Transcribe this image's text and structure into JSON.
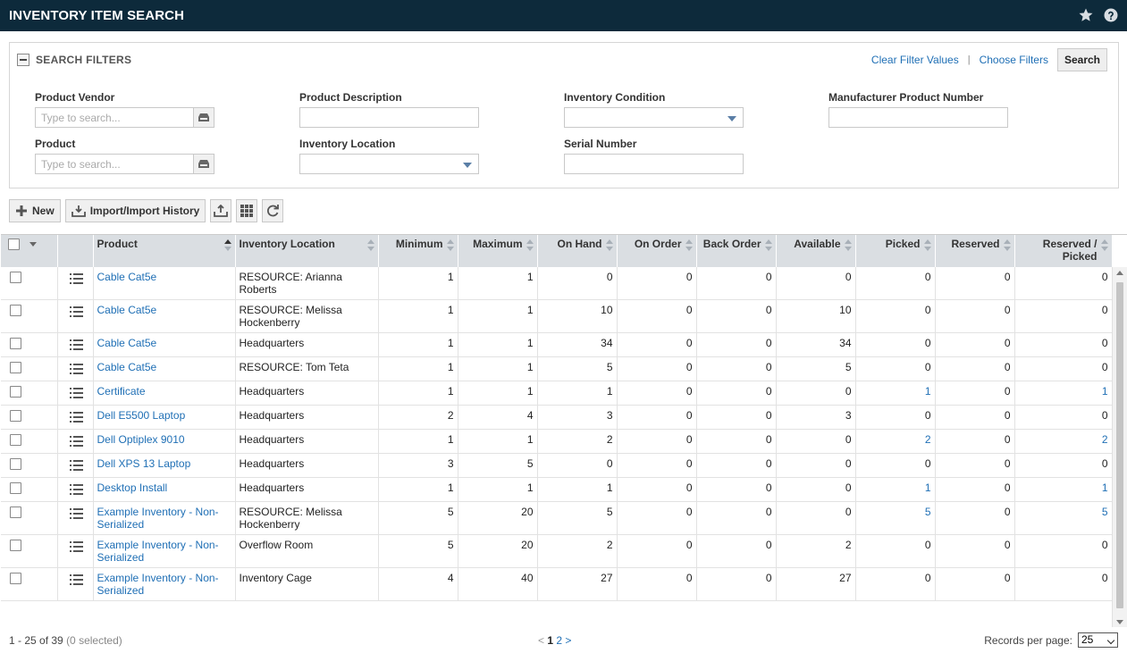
{
  "header": {
    "title": "INVENTORY ITEM SEARCH"
  },
  "filters": {
    "title": "SEARCH FILTERS",
    "clear_label": "Clear Filter Values",
    "choose_label": "Choose Filters",
    "search_label": "Search",
    "fields": {
      "product_vendor": {
        "label": "Product Vendor",
        "placeholder": "Type to search..."
      },
      "product": {
        "label": "Product",
        "placeholder": "Type to search..."
      },
      "product_description": {
        "label": "Product Description",
        "value": ""
      },
      "inventory_location": {
        "label": "Inventory Location",
        "value": ""
      },
      "inventory_condition": {
        "label": "Inventory Condition",
        "value": ""
      },
      "serial_number": {
        "label": "Serial Number",
        "value": ""
      },
      "manufacturer_product_number": {
        "label": "Manufacturer Product Number",
        "value": ""
      }
    }
  },
  "toolbar": {
    "new_label": "New",
    "import_label": "Import/Import History"
  },
  "table": {
    "columns": {
      "product": "Product",
      "location": "Inventory Location",
      "minimum": "Minimum",
      "maximum": "Maximum",
      "on_hand": "On Hand",
      "on_order": "On Order",
      "back_order": "Back Order",
      "available": "Available",
      "picked": "Picked",
      "reserved": "Reserved",
      "reserved_picked_1": "Reserved /",
      "reserved_picked_2": "Picked"
    },
    "rows": [
      {
        "product": "Cable Cat5e",
        "location": "RESOURCE: Arianna Roberts",
        "minimum": "1",
        "maximum": "1",
        "on_hand": "0",
        "on_order": "0",
        "back_order": "0",
        "available": "0",
        "picked": "0",
        "reserved": "0",
        "reserved_picked": "0",
        "picked_link": false
      },
      {
        "product": "Cable Cat5e",
        "location": "RESOURCE: Melissa Hockenberry",
        "minimum": "1",
        "maximum": "1",
        "on_hand": "10",
        "on_order": "0",
        "back_order": "0",
        "available": "10",
        "picked": "0",
        "reserved": "0",
        "reserved_picked": "0",
        "picked_link": false
      },
      {
        "product": "Cable Cat5e",
        "location": "Headquarters",
        "minimum": "1",
        "maximum": "1",
        "on_hand": "34",
        "on_order": "0",
        "back_order": "0",
        "available": "34",
        "picked": "0",
        "reserved": "0",
        "reserved_picked": "0",
        "picked_link": false
      },
      {
        "product": "Cable Cat5e",
        "location": "RESOURCE: Tom Teta",
        "minimum": "1",
        "maximum": "1",
        "on_hand": "5",
        "on_order": "0",
        "back_order": "0",
        "available": "5",
        "picked": "0",
        "reserved": "0",
        "reserved_picked": "0",
        "picked_link": false
      },
      {
        "product": "Certificate",
        "location": "Headquarters",
        "minimum": "1",
        "maximum": "1",
        "on_hand": "1",
        "on_order": "0",
        "back_order": "0",
        "available": "0",
        "picked": "1",
        "reserved": "0",
        "reserved_picked": "1",
        "picked_link": true
      },
      {
        "product": "Dell E5500 Laptop",
        "location": "Headquarters",
        "minimum": "2",
        "maximum": "4",
        "on_hand": "3",
        "on_order": "0",
        "back_order": "0",
        "available": "3",
        "picked": "0",
        "reserved": "0",
        "reserved_picked": "0",
        "picked_link": false
      },
      {
        "product": "Dell Optiplex 9010",
        "location": "Headquarters",
        "minimum": "1",
        "maximum": "1",
        "on_hand": "2",
        "on_order": "0",
        "back_order": "0",
        "available": "0",
        "picked": "2",
        "reserved": "0",
        "reserved_picked": "2",
        "picked_link": true
      },
      {
        "product": "Dell XPS 13 Laptop",
        "location": "Headquarters",
        "minimum": "3",
        "maximum": "5",
        "on_hand": "0",
        "on_order": "0",
        "back_order": "0",
        "available": "0",
        "picked": "0",
        "reserved": "0",
        "reserved_picked": "0",
        "picked_link": false
      },
      {
        "product": "Desktop Install",
        "location": "Headquarters",
        "minimum": "1",
        "maximum": "1",
        "on_hand": "1",
        "on_order": "0",
        "back_order": "0",
        "available": "0",
        "picked": "1",
        "reserved": "0",
        "reserved_picked": "1",
        "picked_link": true
      },
      {
        "product": "Example Inventory - Non-Serialized",
        "location": "RESOURCE: Melissa Hockenberry",
        "minimum": "5",
        "maximum": "20",
        "on_hand": "5",
        "on_order": "0",
        "back_order": "0",
        "available": "0",
        "picked": "5",
        "reserved": "0",
        "reserved_picked": "5",
        "picked_link": true
      },
      {
        "product": "Example Inventory - Non-Serialized",
        "location": "Overflow Room",
        "minimum": "5",
        "maximum": "20",
        "on_hand": "2",
        "on_order": "0",
        "back_order": "0",
        "available": "2",
        "picked": "0",
        "reserved": "0",
        "reserved_picked": "0",
        "picked_link": false
      },
      {
        "product": "Example Inventory - Non-Serialized",
        "location": "Inventory Cage",
        "minimum": "4",
        "maximum": "40",
        "on_hand": "27",
        "on_order": "0",
        "back_order": "0",
        "available": "27",
        "picked": "0",
        "reserved": "0",
        "reserved_picked": "0",
        "picked_link": false
      }
    ]
  },
  "footer": {
    "count": "1 - 25 of 39",
    "selected": "(0 selected)",
    "prev": "<",
    "page_current": "1",
    "page_other": "2",
    "next": ">",
    "rpp_label": "Records per page:",
    "rpp_value": "25"
  }
}
